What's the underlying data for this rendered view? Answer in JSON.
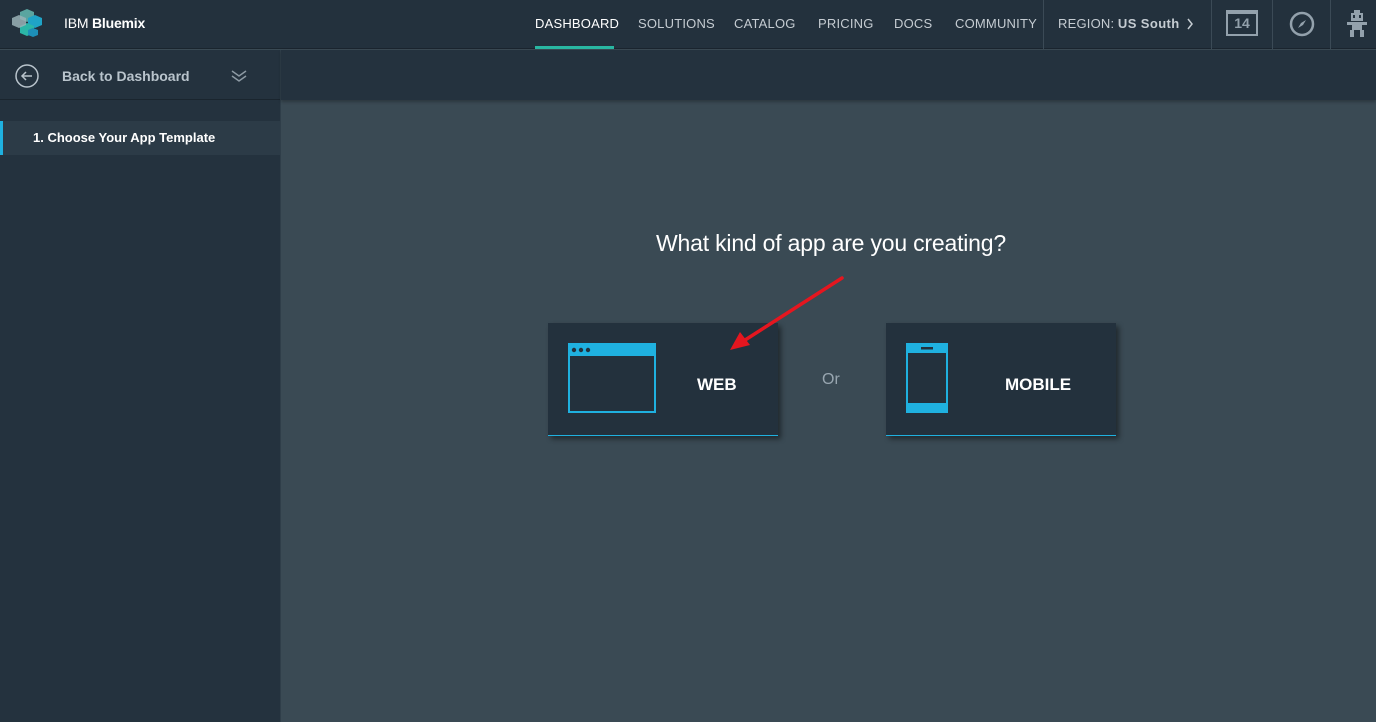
{
  "header": {
    "brand_prefix": "IBM",
    "brand_name": "Bluemix",
    "nav": [
      {
        "label": "DASHBOARD"
      },
      {
        "label": "SOLUTIONS"
      },
      {
        "label": "CATALOG"
      },
      {
        "label": "PRICING"
      },
      {
        "label": "DOCS"
      },
      {
        "label": "COMMUNITY"
      }
    ],
    "active_nav": "DASHBOARD",
    "region_label": "REGION:",
    "region_value": "US South",
    "calendar_count": "14",
    "icons": [
      "chevron-right-icon",
      "calendar-icon",
      "compass-icon",
      "robot-avatar-icon"
    ]
  },
  "sidebar": {
    "back_label": "Back to Dashboard",
    "steps": [
      {
        "label": "1. Choose Your App Template"
      }
    ],
    "icons": [
      "arrow-left-circle-icon",
      "double-chevron-down-icon"
    ]
  },
  "main": {
    "question": "What kind of app are you creating?",
    "or_text": "Or",
    "options": [
      {
        "label": "WEB",
        "icon": "browser-window-icon"
      },
      {
        "label": "MOBILE",
        "icon": "mobile-phone-icon"
      }
    ]
  },
  "colors": {
    "accent_teal": "#29b7a2",
    "accent_blue": "#1fb1e0",
    "nav_bg": "#23313d",
    "content_bg": "#3a4a54",
    "annotation_red": "#e5161f"
  }
}
